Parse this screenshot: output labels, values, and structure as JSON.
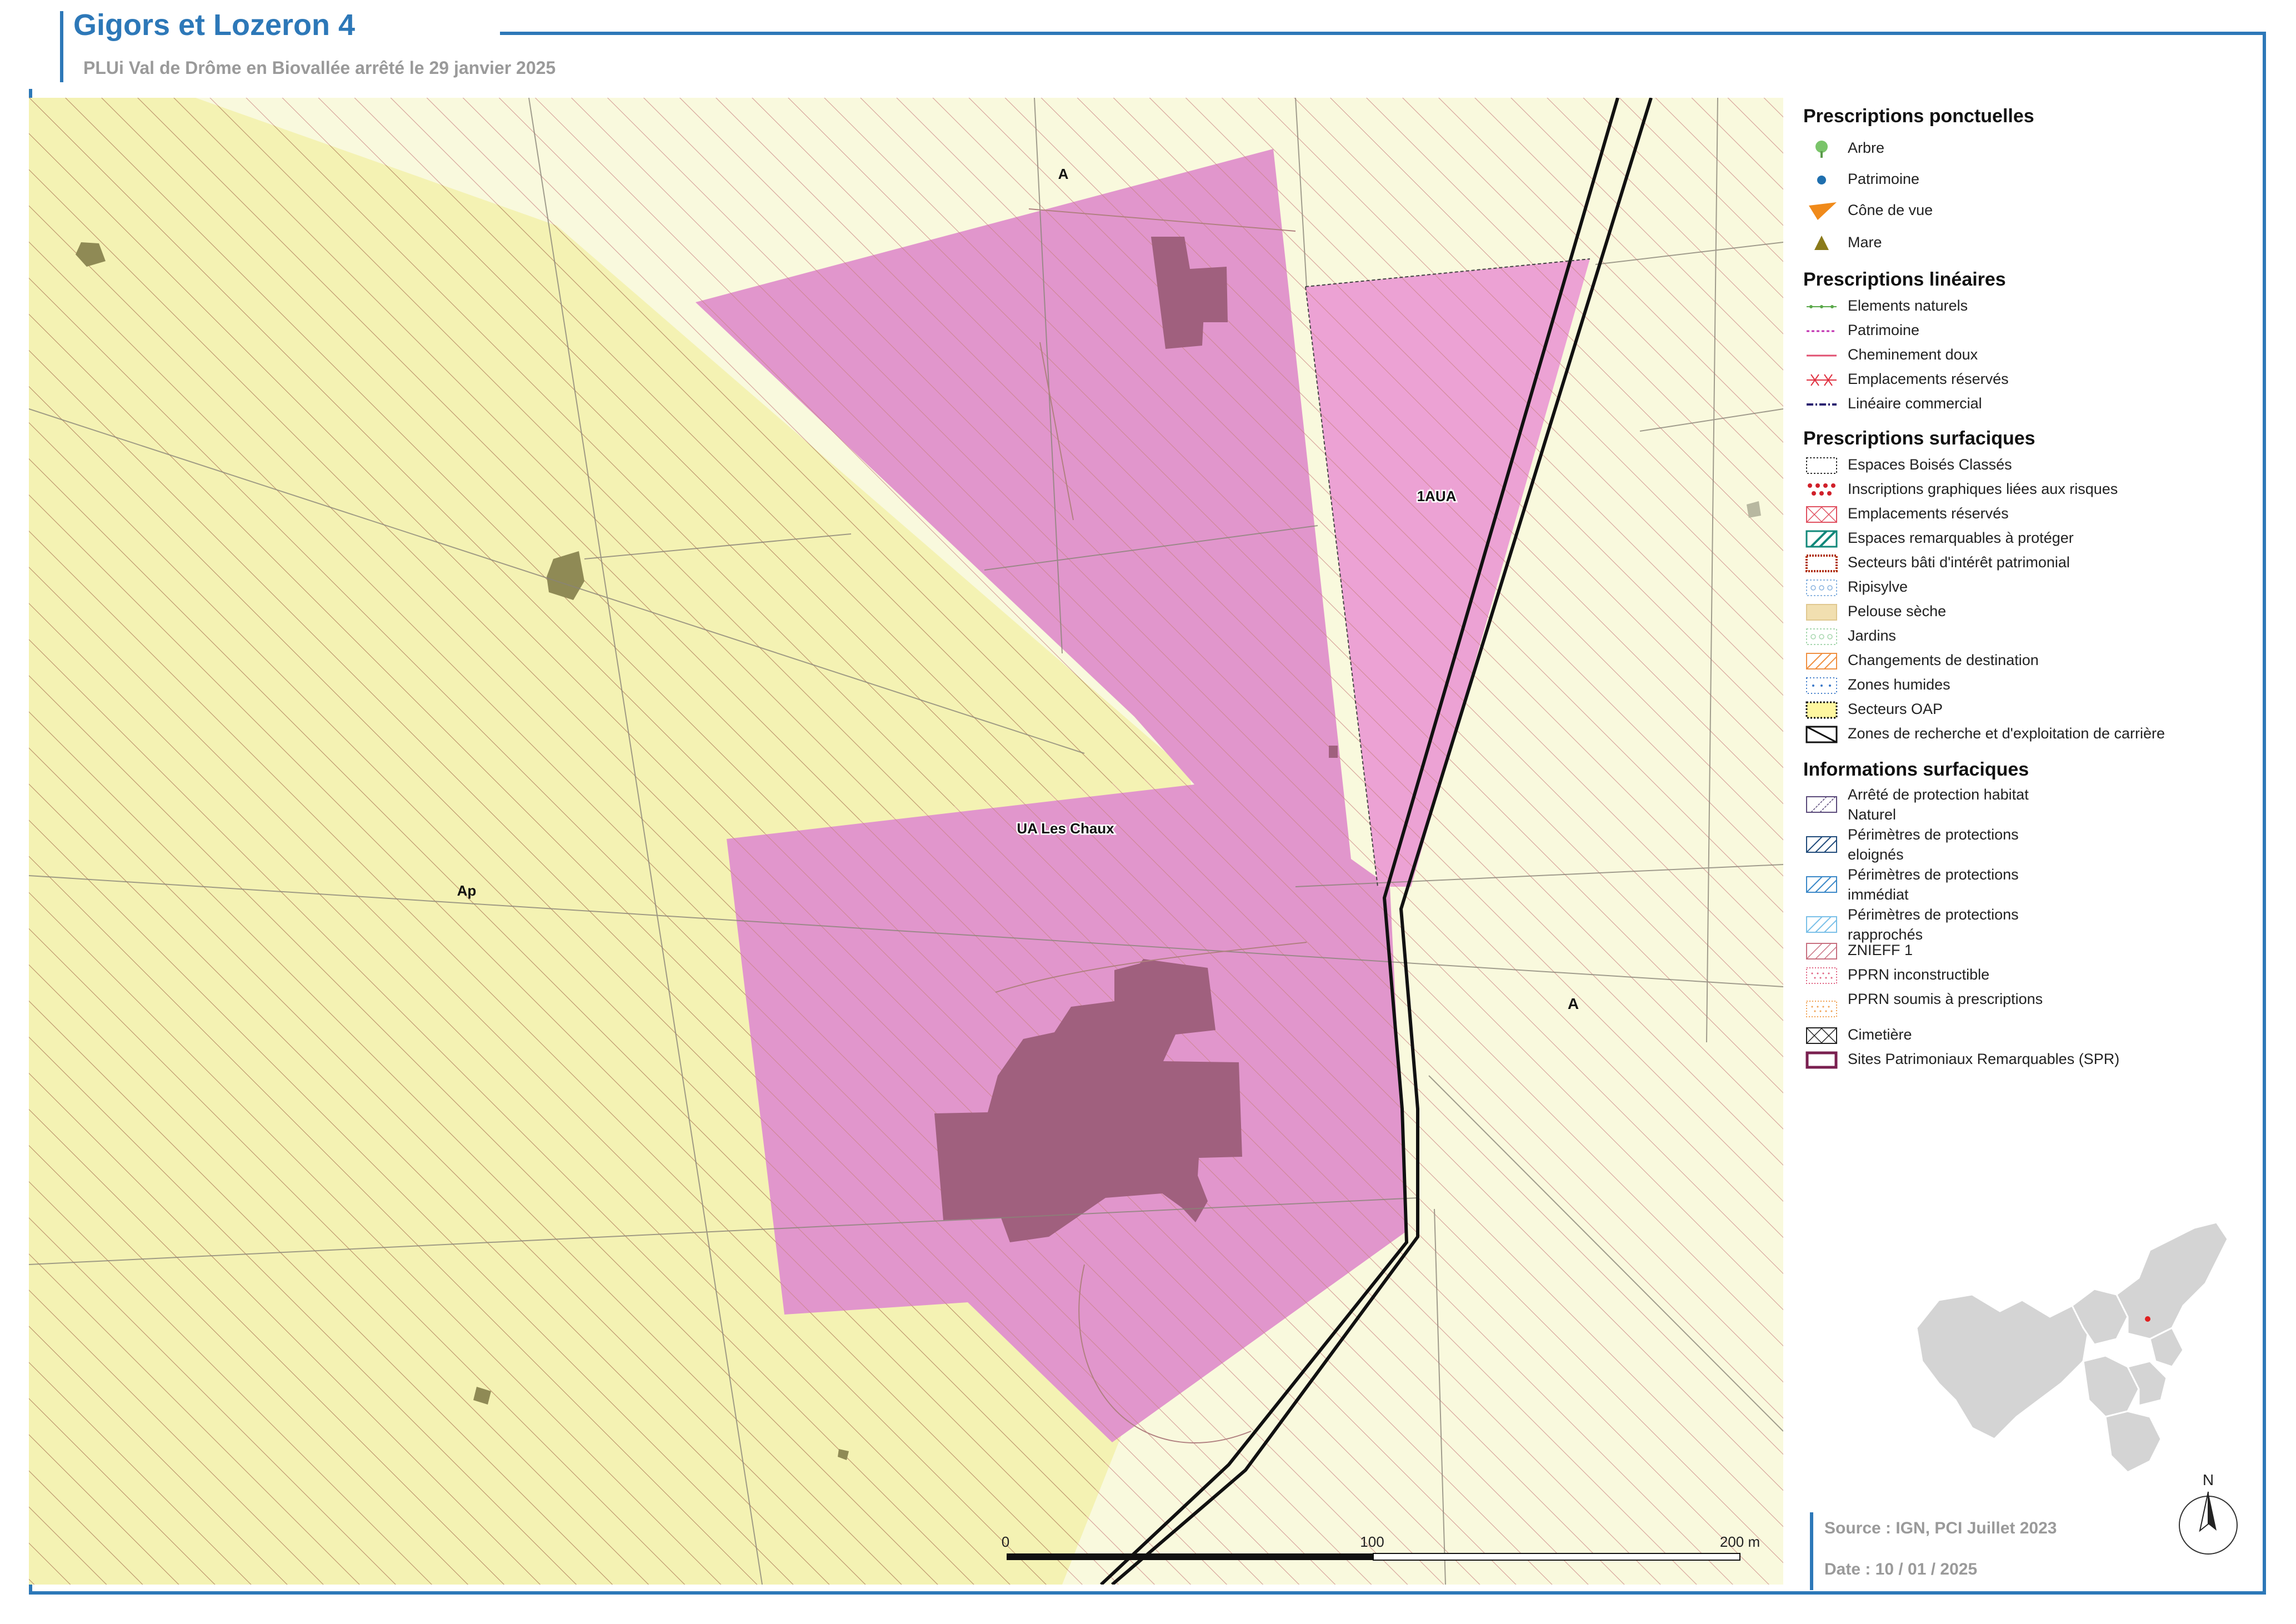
{
  "header": {
    "title": "Gigors et Lozeron 4",
    "subtitle": "PLUi Val de Drôme en Biovallée arrêté le 29 janvier 2025"
  },
  "map": {
    "zone_labels": [
      "A",
      "1AUA",
      "UA Les Chaux",
      "Ap",
      "A"
    ],
    "scale_bar": {
      "zero": "0",
      "mid": "100",
      "end": "200 m"
    },
    "colors": {
      "zone_a": "#f9f9dd",
      "zone_ap": "#f4f2b3",
      "zone_ua": "#e196cc",
      "zone_1aua": "#eca2d4",
      "buildings": "#a0607e",
      "hatch": "#c07070",
      "frame": "#2d78b8"
    }
  },
  "legend": {
    "sections": [
      {
        "title": "Prescriptions ponctuelles",
        "items": [
          {
            "label": "Arbre",
            "symbol": "tree-icon"
          },
          {
            "label": "Patrimoine",
            "symbol": "dot-icon"
          },
          {
            "label": "Cône de vue",
            "symbol": "view-cone-icon"
          },
          {
            "label": "Mare",
            "symbol": "triangle-icon"
          }
        ]
      },
      {
        "title": "Prescriptions linéaires",
        "items": [
          {
            "label": "Elements naturels",
            "symbol": "green-dotted-line"
          },
          {
            "label": "Patrimoine",
            "symbol": "magenta-dashed-line"
          },
          {
            "label": "Cheminement doux",
            "symbol": "red-line"
          },
          {
            "label": "Emplacements réservés",
            "symbol": "red-cross-line"
          },
          {
            "label": "Linéaire commercial",
            "symbol": "navy-dash-dot-line"
          }
        ]
      },
      {
        "title": "Prescriptions surfaciques",
        "items": [
          {
            "label": "Espaces Boisés Classés",
            "symbol": "ebc-box"
          },
          {
            "label": "Inscriptions graphiques liées aux risques",
            "symbol": "risk-dots-box"
          },
          {
            "label": "Emplacements réservés",
            "symbol": "cross-hatch-red-box"
          },
          {
            "label": "Espaces remarquables à protéger",
            "symbol": "teal-hatch-box"
          },
          {
            "label": "Secteurs bâti d'intérêt patrimonial",
            "symbol": "dotted-orange-box"
          },
          {
            "label": "Ripisylve",
            "symbol": "blue-circles-box"
          },
          {
            "label": "Pelouse sèche",
            "symbol": "beige-fill-box"
          },
          {
            "label": "Jardins",
            "symbol": "green-circles-box"
          },
          {
            "label": "Changements de destination",
            "symbol": "orange-hatch-box"
          },
          {
            "label": "Zones humides",
            "symbol": "blue-dots-box"
          },
          {
            "label": "Secteurs OAP",
            "symbol": "yellow-dotted-box"
          },
          {
            "label": "Zones de recherche et d'exploitation de carrière",
            "symbol": "black-hatch-box"
          }
        ]
      },
      {
        "title": "Informations surfaciques",
        "items": [
          {
            "label": "Arrêté de protection habitat Naturel",
            "symbol": "purple-hatch-box"
          },
          {
            "label": "Périmètres de protections eloignés",
            "symbol": "navy-hatch-box"
          },
          {
            "label": "Périmètres de protections immédiat",
            "symbol": "blue-hatch-box"
          },
          {
            "label": "Périmètres de protections rapprochés",
            "symbol": "light-blue-hatch-box"
          },
          {
            "label": "ZNIEFF 1",
            "symbol": "pink-hatch-box"
          },
          {
            "label": "PPRN inconstructible",
            "symbol": "pink-dots-box"
          },
          {
            "label": "PPRN soumis à prescriptions",
            "symbol": "orange-dots-box"
          },
          {
            "label": "Cimetière",
            "symbol": "cross-box"
          },
          {
            "label": "Sites Patrimoniaux Remarquables (SPR)",
            "symbol": "purple-outline-box"
          }
        ]
      }
    ]
  },
  "footer": {
    "source": "Source : IGN, PCI Juillet 2023",
    "date": "Date : 10 / 01 / 2025",
    "north_label": "N"
  }
}
